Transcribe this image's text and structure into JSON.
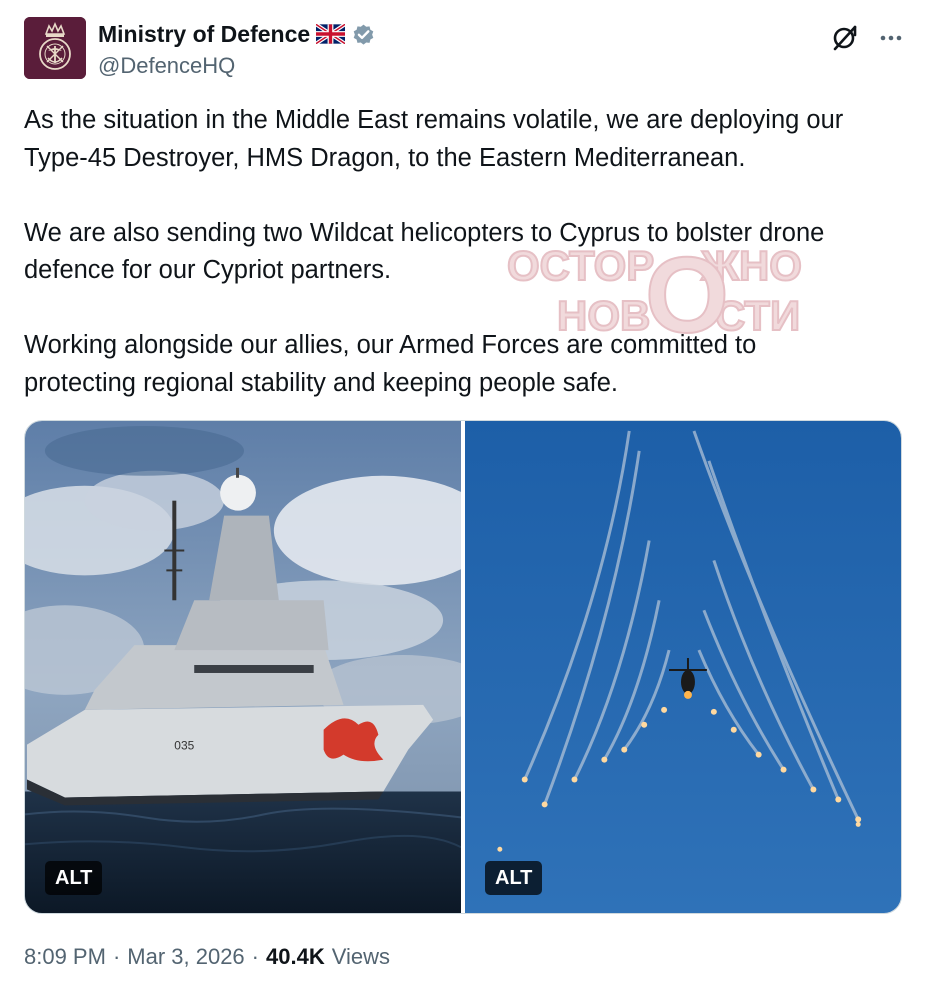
{
  "author": {
    "display_name": "Ministry of Defence",
    "handle": "@DefenceHQ",
    "avatar_icon": "mod-crest-icon",
    "flag_icon": "uk-flag-icon",
    "verified_icon": "verified-badge-icon",
    "brand_color": "#5a1d3a"
  },
  "actions": {
    "grok_icon": "grok-icon",
    "more_icon": "more-icon"
  },
  "tweet": {
    "paragraphs": [
      "As the situation in the Middle East remains volatile, we are deploying our\nType-45 Destroyer, HMS Dragon, to the Eastern Mediterranean.",
      "We are also sending two Wildcat helicopters to Cyprus to bolster drone\ndefence for our Cypriot partners.",
      "Working alongside our allies, our Armed Forces are committed to\nprotecting regional stability and keeping people safe."
    ]
  },
  "watermark": {
    "line1": "ОСТОР",
    "line1b": "ЖНО",
    "line2": "НОВ",
    "line2b": "СТИ",
    "big_letter": "О",
    "color": "#e8c8cc"
  },
  "media": [
    {
      "alt_label": "ALT",
      "subject": "ship-photo"
    },
    {
      "alt_label": "ALT",
      "subject": "helicopter-flares-photo"
    }
  ],
  "meta": {
    "time": "8:09 PM",
    "sep1": "·",
    "date": "Mar 3, 2026",
    "sep2": "·",
    "views_count": "40.4K",
    "views_label": "Views"
  },
  "colors": {
    "text": "#0f1419",
    "secondary": "#536471",
    "verified": "#829aab",
    "border": "#cfd9de"
  }
}
